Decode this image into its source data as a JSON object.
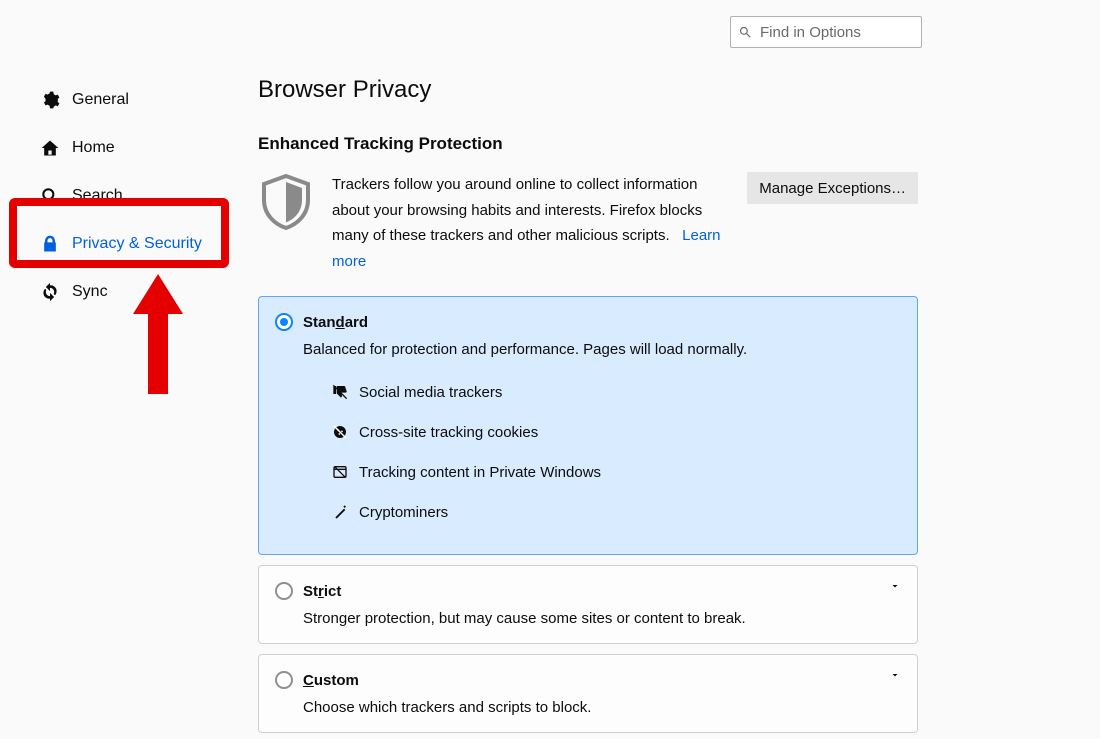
{
  "search": {
    "placeholder": "Find in Options"
  },
  "sidebar": {
    "items": [
      {
        "label": "General"
      },
      {
        "label": "Home"
      },
      {
        "label": "Search"
      },
      {
        "label": "Privacy & Security"
      },
      {
        "label": "Sync"
      }
    ]
  },
  "main": {
    "title": "Browser Privacy",
    "section_title": "Enhanced Tracking Protection",
    "desc": "Trackers follow you around online to collect information about your browsing habits and interests. Firefox blocks many of these trackers and other malicious scripts.",
    "learn_more": "Learn more",
    "manage_label": "Manage Exceptions…",
    "options": {
      "standard": {
        "label_pre": "Stan",
        "label_ul": "d",
        "label_post": "ard",
        "desc": "Balanced for protection and performance. Pages will load normally.",
        "items": [
          "Social media trackers",
          "Cross-site tracking cookies",
          "Tracking content in Private Windows",
          "Cryptominers"
        ]
      },
      "strict": {
        "label_pre": "St",
        "label_ul": "r",
        "label_post": "ict",
        "desc": "Stronger protection, but may cause some sites or content to break."
      },
      "custom": {
        "label_pre": "",
        "label_ul": "C",
        "label_post": "ustom",
        "desc": "Choose which trackers and scripts to block."
      }
    }
  }
}
